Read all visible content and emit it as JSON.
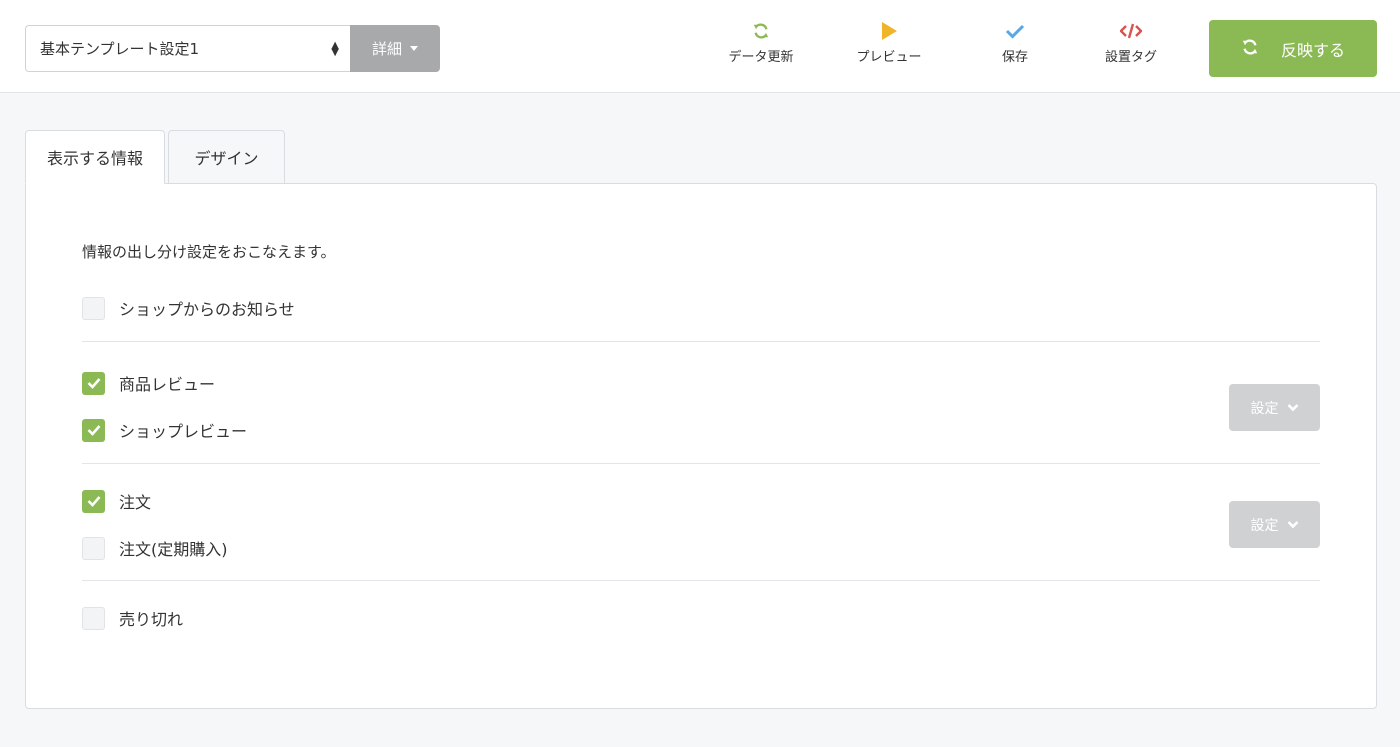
{
  "toolbar": {
    "template_select_value": "基本テンプレート設定1",
    "detail_label": "詳細",
    "refresh_label": "データ更新",
    "preview_label": "プレビュー",
    "save_label": "保存",
    "tag_label": "設置タグ",
    "publish_label": "反映する"
  },
  "tabs": [
    {
      "label": "表示する情報",
      "active": true
    },
    {
      "label": "デザイン",
      "active": false
    }
  ],
  "panel": {
    "description": "情報の出し分け設定をおこなえます。",
    "options": [
      {
        "label": "ショップからのお知らせ",
        "checked": false
      },
      {
        "label": "商品レビュー",
        "checked": true
      },
      {
        "label": "ショップレビュー",
        "checked": true
      },
      {
        "label": "注文",
        "checked": true
      },
      {
        "label": "注文(定期購入)",
        "checked": false
      },
      {
        "label": "売り切れ",
        "checked": false
      }
    ],
    "setting_label": "設定"
  },
  "colors": {
    "accent_green": "#8bba55",
    "preview_yellow": "#f0b429",
    "save_blue": "#5aa7e6",
    "tag_red": "#d9534f",
    "disabled_gray": "#cfd1d3"
  },
  "icons": {
    "refresh": "refresh-icon",
    "preview": "play-icon",
    "save": "check-icon",
    "tag": "code-icon",
    "publish": "refresh-icon",
    "setting": "chevron-down-icon"
  }
}
